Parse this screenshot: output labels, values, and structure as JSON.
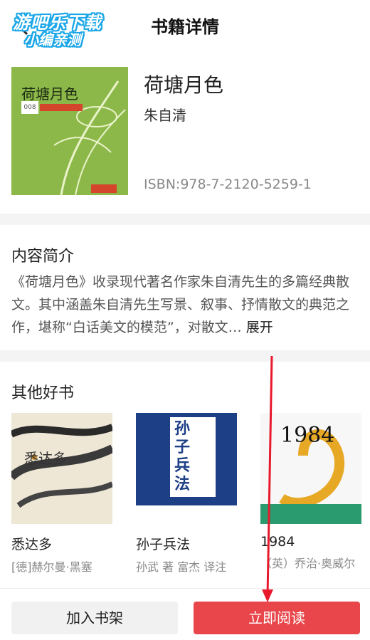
{
  "header": {
    "title": "书籍详情"
  },
  "watermark": {
    "line1": "游吧乐下载",
    "line2": "小编亲测"
  },
  "book": {
    "cover_title": "荷塘月色",
    "cover_badge": "008",
    "title": "荷塘月色",
    "author": "朱自清",
    "isbn": "ISBN:978-7-2120-5259-1"
  },
  "intro": {
    "heading": "内容简介",
    "text": "《荷塘月色》收录现代著名作家朱自清先生的多篇经典散文。其中涵盖朱自清先生写景、叙事、抒情散文的典范之作，堪称“白话美文的模范”，对散文…",
    "more": "展开"
  },
  "others": {
    "heading": "其他好书",
    "books": [
      {
        "name": "悉达多",
        "author": "[德]赫尔曼·黑塞",
        "cover_text": "悉达多"
      },
      {
        "name": "孙子兵法",
        "author": "孙武 著 富杰 译注",
        "cover_text": "孙子兵法"
      },
      {
        "name": "1984",
        "author": "（英）乔治·奥威尔",
        "cover_text": "1984"
      }
    ]
  },
  "footer": {
    "add_shelf": "加入书架",
    "read_now": "立即阅读"
  },
  "colors": {
    "accent": "#e8464a",
    "cover_green": "#8cb84a",
    "watermark_blue": "#1aa6e8"
  }
}
